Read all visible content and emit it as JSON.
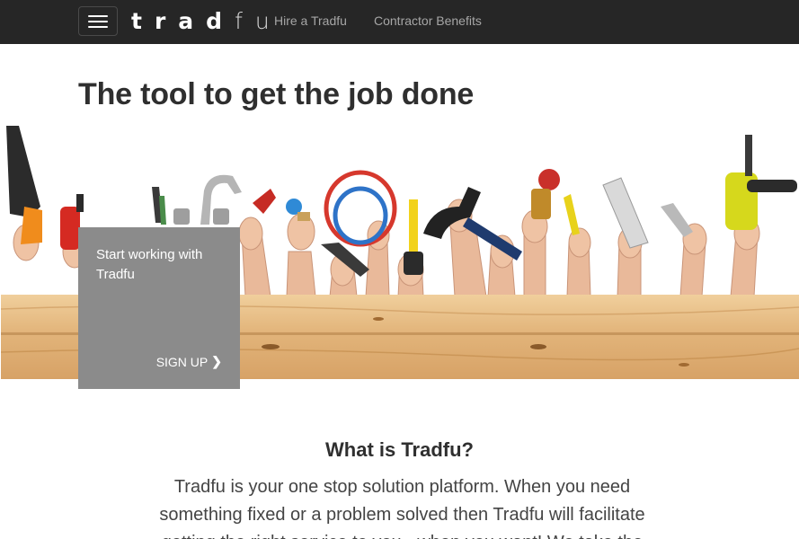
{
  "nav": {
    "menu_icon": "hamburger-menu-icon",
    "brand": [
      "t",
      "r",
      "a",
      "d",
      "f",
      "u"
    ],
    "links": [
      {
        "label": "Hire a Tradfu"
      },
      {
        "label": "Contractor Benefits"
      }
    ]
  },
  "hero": {
    "title": "The tool to get the job done",
    "image": "hands-holding-tools-over-wood-plank"
  },
  "signup_card": {
    "text": "Start working with Tradfu",
    "button_label": "SIGN UP",
    "button_icon": "chevron-right-icon"
  },
  "about": {
    "title": "What is Tradfu?",
    "text": "Tradfu is your one stop solution platform. When you need something fixed or a problem solved then Tradfu will facilitate getting the right service to you - when you want! We take the"
  },
  "colors": {
    "navbar": "#262626",
    "nav_link": "#a6a6a6",
    "card": "#8b8b8b",
    "wood": "#e2b67e"
  }
}
